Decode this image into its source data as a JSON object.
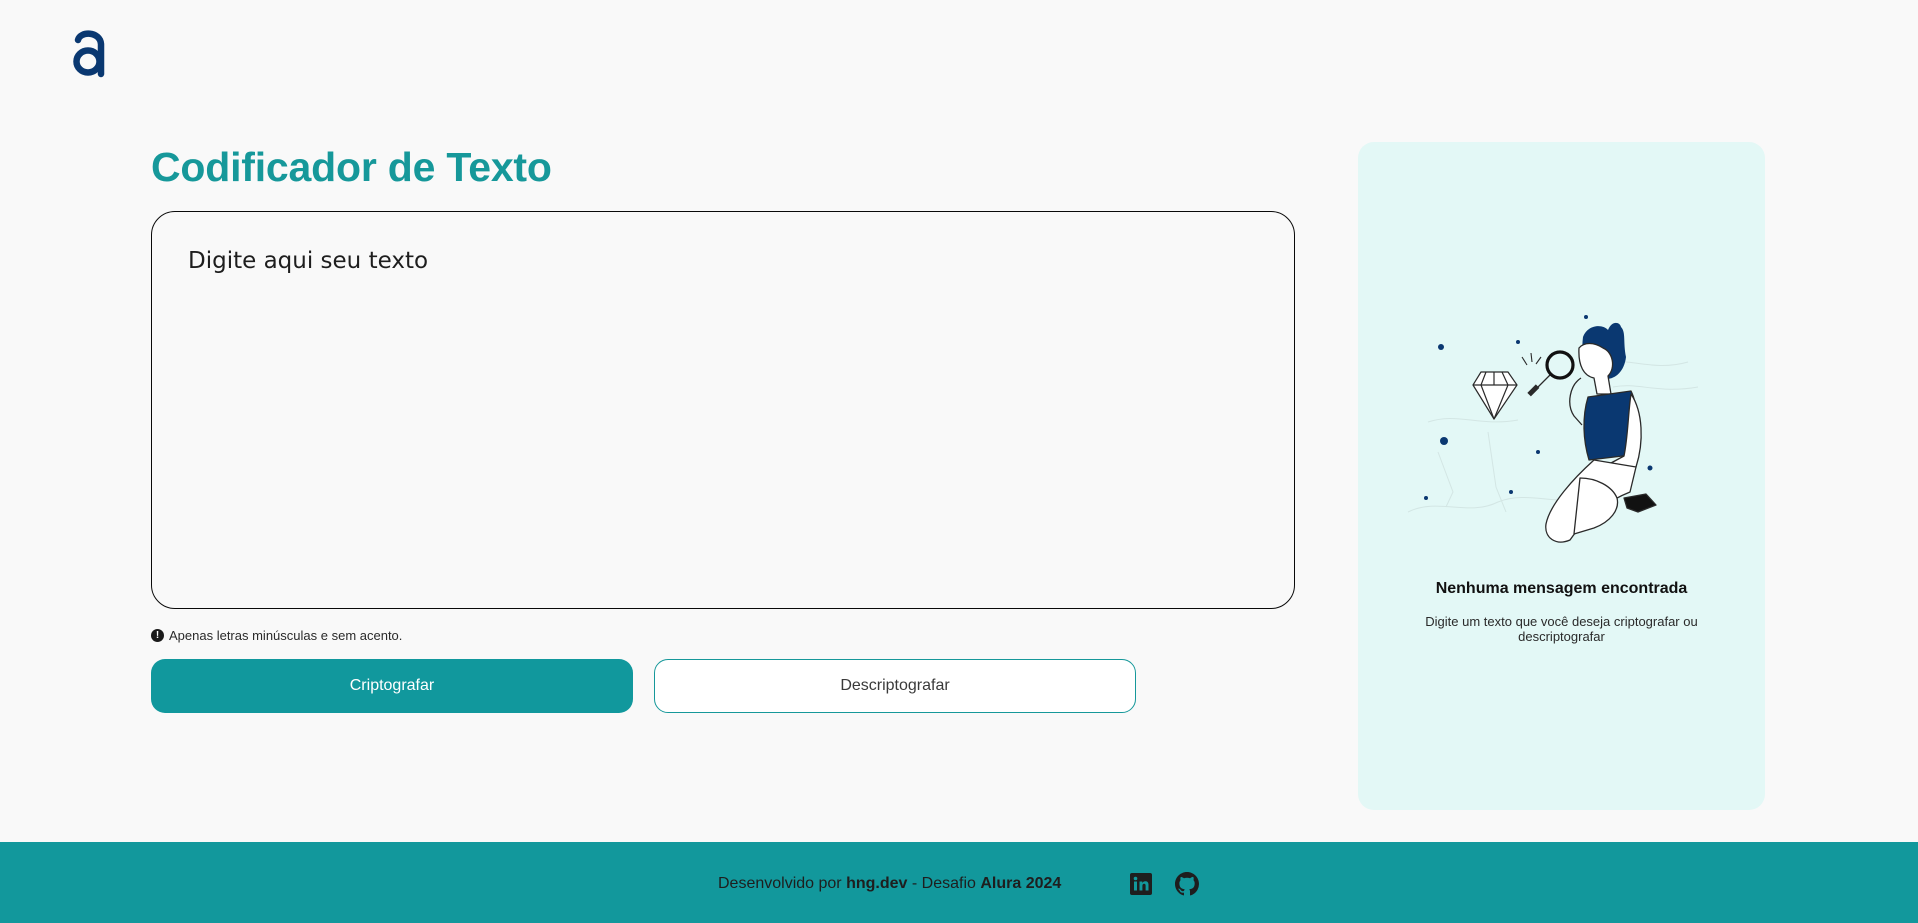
{
  "header": {
    "logo_name": "alura-logo"
  },
  "main": {
    "title": "Codificador de Texto",
    "input_placeholder": "Digite aqui seu texto",
    "hint": "Apenas letras minúsculas e sem acento.",
    "encrypt_label": "Criptografar",
    "decrypt_label": "Descriptografar"
  },
  "panel": {
    "heading": "Nenhuma mensagem encontrada",
    "text": "Digite um texto que você deseja criptografar ou descriptografar"
  },
  "footer": {
    "prefix": "Desenvolvido por ",
    "author": "hng.dev",
    "middle": " - Desafio ",
    "challenge": "Alura 2024"
  },
  "icons": {
    "info": "info-icon",
    "linkedin": "linkedin-icon",
    "github": "github-icon"
  },
  "colors": {
    "accent": "#16989a",
    "button": "#11989d",
    "panel": "#e3f8f6",
    "footer": "#12989c",
    "navy": "#0a3871"
  }
}
